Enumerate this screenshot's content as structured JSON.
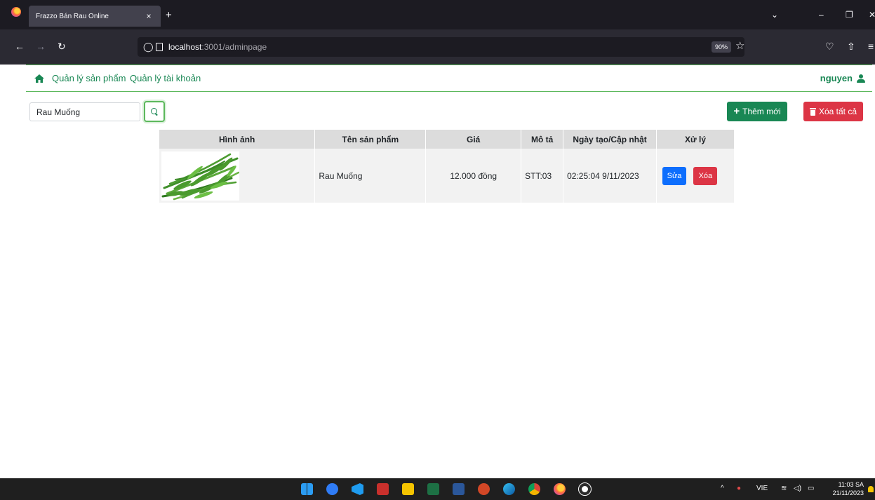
{
  "browser": {
    "tab_title": "Frazzo Bán Rau Online",
    "tab_close": "×",
    "new_tab": "+",
    "url_host": "localhost",
    "url_path": ":3001/adminpage",
    "zoom": "90%",
    "icons": [
      "firefox-logo-icon",
      "back-icon",
      "forward-icon",
      "reload-icon",
      "shield-icon",
      "page-icon",
      "bookmark-star-icon",
      "pocket-icon",
      "extensions-icon",
      "menu-icon",
      "tab-list-icon",
      "minimize-icon",
      "maximize-icon",
      "close-window-icon"
    ]
  },
  "app_nav": {
    "products_link": "Quản lý sản phẩm",
    "accounts_link": "Quản lý tài khoản",
    "username": "nguyen",
    "accent_color": "#198754"
  },
  "toolbar": {
    "search_value": "Rau Muống",
    "add_label": "Thêm mới",
    "delete_all_label": "Xóa tất cả"
  },
  "table": {
    "headers": [
      "Hình ảnh",
      "Tên sản phẩm",
      "Giá",
      "Mô tả",
      "Ngày tạo/Cập nhật",
      "Xử lý"
    ],
    "rows": [
      {
        "name": "Rau Muống",
        "price": "12.000 đồng",
        "description": "STT:03",
        "date": "02:25:04 9/11/2023",
        "edit_label": "Sửa",
        "delete_label": "Xóa"
      }
    ]
  },
  "taskbar": {
    "lang": "VIE",
    "time": "11:03 SA",
    "date": "21/11/2023",
    "tray_up": "^"
  }
}
